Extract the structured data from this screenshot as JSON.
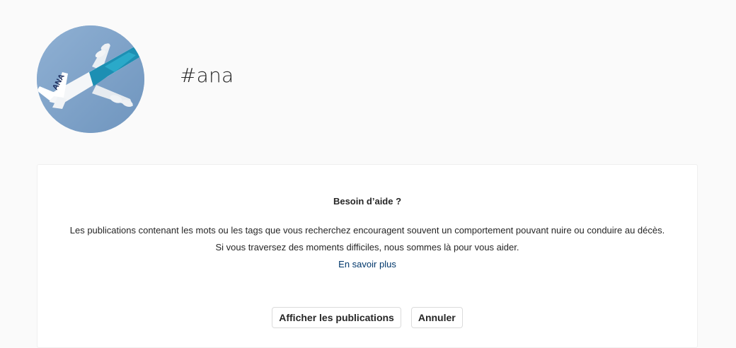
{
  "header": {
    "avatar_alt": "airplane",
    "hashtag": "#ana"
  },
  "notice": {
    "title": "Besoin d’aide ?",
    "line1": "Les publications contenant les mots ou les tags que vous recherchez encouragent souvent un comportement pouvant nuire ou conduire au décès.",
    "line2": "Si vous traversez des moments difficiles, nous sommes là pour vous aider.",
    "learn_more": "En savoir plus",
    "show_posts_button": "Afficher les publications",
    "cancel_button": "Annuler"
  },
  "colors": {
    "background": "#fafafa",
    "card": "#ffffff",
    "link": "#00376b",
    "text": "#262626"
  }
}
